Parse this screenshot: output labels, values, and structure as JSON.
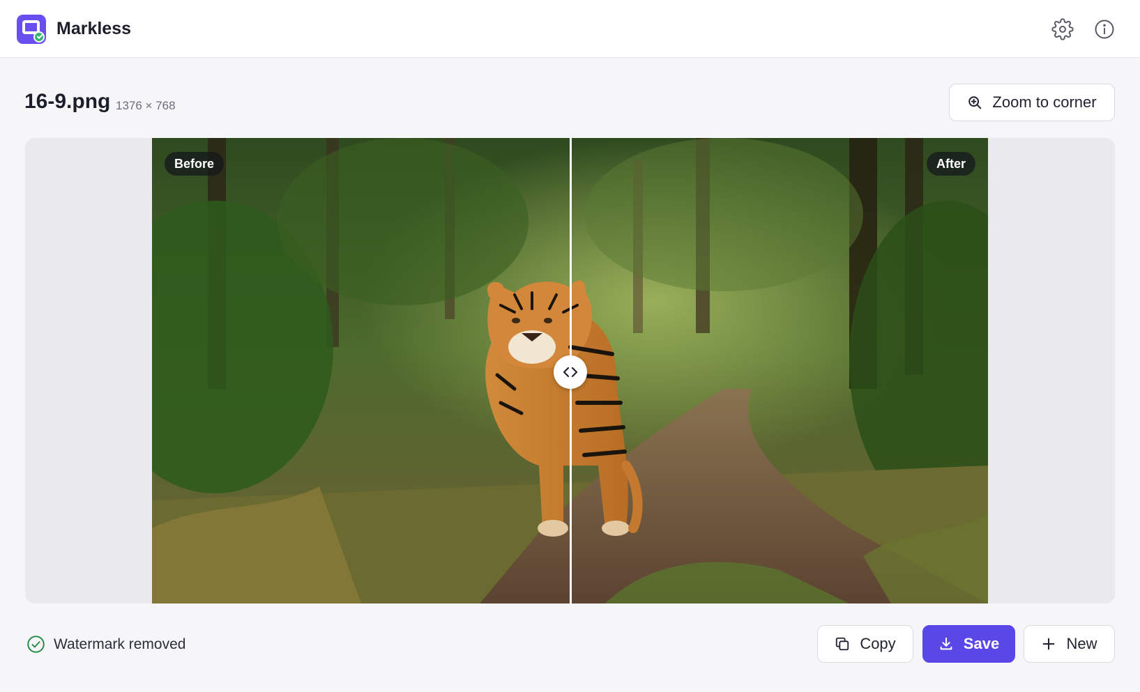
{
  "app": {
    "title": "Markless"
  },
  "header": {
    "settings_icon": "gear-icon",
    "info_icon": "info-icon"
  },
  "file": {
    "name": "16-9.png",
    "dimensions": "1376 × 768"
  },
  "toolbar": {
    "zoom_label": "Zoom to corner"
  },
  "comparison": {
    "before_label": "Before",
    "after_label": "After",
    "split_position": 0.5
  },
  "status": {
    "text": "Watermark removed",
    "color": "#2f8a4e"
  },
  "actions": {
    "copy_label": "Copy",
    "save_label": "Save",
    "new_label": "New"
  },
  "colors": {
    "accent": "#5a47e8",
    "brand": "#6a4ff0"
  }
}
